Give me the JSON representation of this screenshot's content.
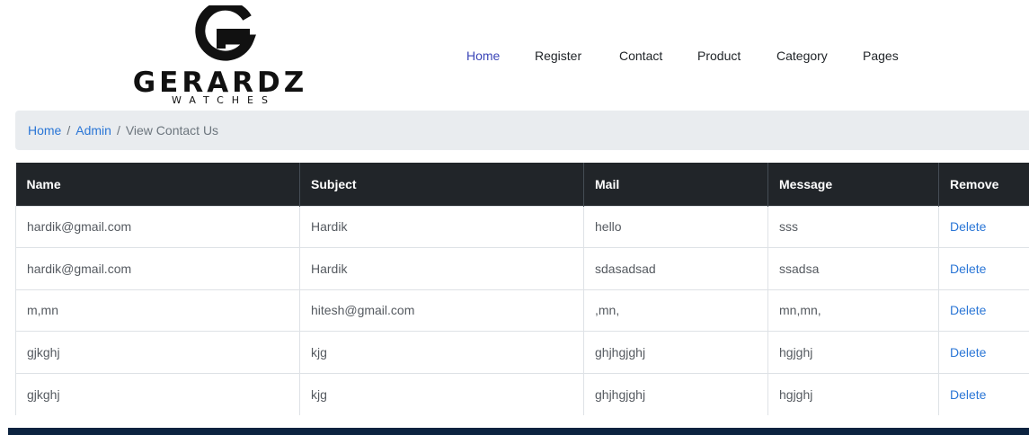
{
  "brand": {
    "name": "GERARDZ",
    "tagline": "WATCHES"
  },
  "nav": {
    "items": [
      {
        "label": "Home",
        "active": true
      },
      {
        "label": "Register",
        "active": false
      },
      {
        "label": "Contact",
        "active": false
      },
      {
        "label": "Product",
        "active": false
      },
      {
        "label": "Category",
        "active": false
      },
      {
        "label": "Pages",
        "active": false
      }
    ]
  },
  "breadcrumb": {
    "items": [
      "Home",
      "Admin",
      "View Contact Us"
    ],
    "separator": "/"
  },
  "table": {
    "headers": [
      "Name",
      "Subject",
      "Mail",
      "Message",
      "Remove"
    ],
    "rows": [
      [
        "hardik@gmail.com",
        "Hardik",
        "hello",
        "sss",
        "Delete"
      ],
      [
        "hardik@gmail.com",
        "Hardik",
        "sdasadsad",
        "ssadsa",
        "Delete"
      ],
      [
        "m,mn",
        "hitesh@gmail.com",
        ",mn,",
        "mn,mn,",
        "Delete"
      ],
      [
        "gjkghj",
        "kjg",
        "ghjhgjghj",
        "hgjghj",
        "Delete"
      ],
      [
        "gjkghj",
        "kjg",
        "ghjhgjghj",
        "hgjghj",
        "Delete"
      ]
    ]
  },
  "colors": {
    "nav_active": "#3b46b8",
    "link": "#2a76d6",
    "table_header_bg": "#212529",
    "breadcrumb_bg": "#e9ecef",
    "footer_bg": "#0c2340"
  }
}
